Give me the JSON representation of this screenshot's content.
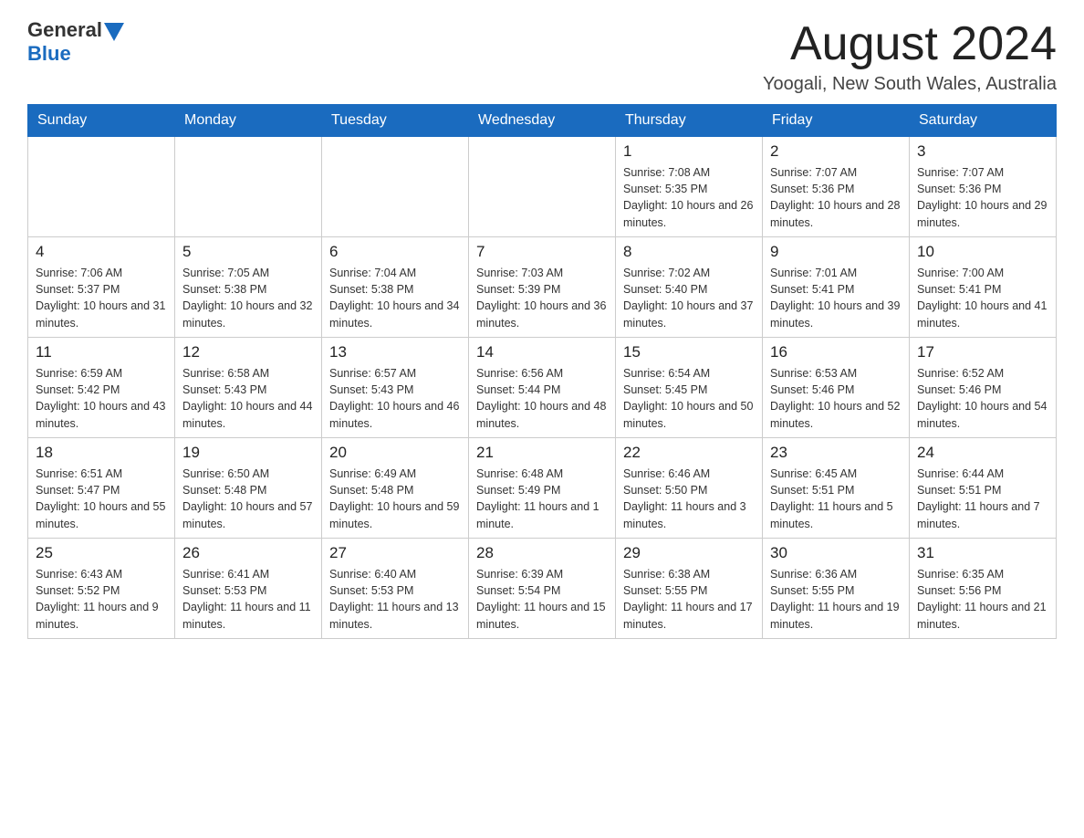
{
  "header": {
    "logo": {
      "general": "General",
      "blue": "Blue"
    },
    "title": "August 2024",
    "location": "Yoogali, New South Wales, Australia"
  },
  "calendar": {
    "days_of_week": [
      "Sunday",
      "Monday",
      "Tuesday",
      "Wednesday",
      "Thursday",
      "Friday",
      "Saturday"
    ],
    "weeks": [
      [
        {
          "num": "",
          "sunrise": "",
          "sunset": "",
          "daylight": ""
        },
        {
          "num": "",
          "sunrise": "",
          "sunset": "",
          "daylight": ""
        },
        {
          "num": "",
          "sunrise": "",
          "sunset": "",
          "daylight": ""
        },
        {
          "num": "",
          "sunrise": "",
          "sunset": "",
          "daylight": ""
        },
        {
          "num": "1",
          "sunrise": "Sunrise: 7:08 AM",
          "sunset": "Sunset: 5:35 PM",
          "daylight": "Daylight: 10 hours and 26 minutes."
        },
        {
          "num": "2",
          "sunrise": "Sunrise: 7:07 AM",
          "sunset": "Sunset: 5:36 PM",
          "daylight": "Daylight: 10 hours and 28 minutes."
        },
        {
          "num": "3",
          "sunrise": "Sunrise: 7:07 AM",
          "sunset": "Sunset: 5:36 PM",
          "daylight": "Daylight: 10 hours and 29 minutes."
        }
      ],
      [
        {
          "num": "4",
          "sunrise": "Sunrise: 7:06 AM",
          "sunset": "Sunset: 5:37 PM",
          "daylight": "Daylight: 10 hours and 31 minutes."
        },
        {
          "num": "5",
          "sunrise": "Sunrise: 7:05 AM",
          "sunset": "Sunset: 5:38 PM",
          "daylight": "Daylight: 10 hours and 32 minutes."
        },
        {
          "num": "6",
          "sunrise": "Sunrise: 7:04 AM",
          "sunset": "Sunset: 5:38 PM",
          "daylight": "Daylight: 10 hours and 34 minutes."
        },
        {
          "num": "7",
          "sunrise": "Sunrise: 7:03 AM",
          "sunset": "Sunset: 5:39 PM",
          "daylight": "Daylight: 10 hours and 36 minutes."
        },
        {
          "num": "8",
          "sunrise": "Sunrise: 7:02 AM",
          "sunset": "Sunset: 5:40 PM",
          "daylight": "Daylight: 10 hours and 37 minutes."
        },
        {
          "num": "9",
          "sunrise": "Sunrise: 7:01 AM",
          "sunset": "Sunset: 5:41 PM",
          "daylight": "Daylight: 10 hours and 39 minutes."
        },
        {
          "num": "10",
          "sunrise": "Sunrise: 7:00 AM",
          "sunset": "Sunset: 5:41 PM",
          "daylight": "Daylight: 10 hours and 41 minutes."
        }
      ],
      [
        {
          "num": "11",
          "sunrise": "Sunrise: 6:59 AM",
          "sunset": "Sunset: 5:42 PM",
          "daylight": "Daylight: 10 hours and 43 minutes."
        },
        {
          "num": "12",
          "sunrise": "Sunrise: 6:58 AM",
          "sunset": "Sunset: 5:43 PM",
          "daylight": "Daylight: 10 hours and 44 minutes."
        },
        {
          "num": "13",
          "sunrise": "Sunrise: 6:57 AM",
          "sunset": "Sunset: 5:43 PM",
          "daylight": "Daylight: 10 hours and 46 minutes."
        },
        {
          "num": "14",
          "sunrise": "Sunrise: 6:56 AM",
          "sunset": "Sunset: 5:44 PM",
          "daylight": "Daylight: 10 hours and 48 minutes."
        },
        {
          "num": "15",
          "sunrise": "Sunrise: 6:54 AM",
          "sunset": "Sunset: 5:45 PM",
          "daylight": "Daylight: 10 hours and 50 minutes."
        },
        {
          "num": "16",
          "sunrise": "Sunrise: 6:53 AM",
          "sunset": "Sunset: 5:46 PM",
          "daylight": "Daylight: 10 hours and 52 minutes."
        },
        {
          "num": "17",
          "sunrise": "Sunrise: 6:52 AM",
          "sunset": "Sunset: 5:46 PM",
          "daylight": "Daylight: 10 hours and 54 minutes."
        }
      ],
      [
        {
          "num": "18",
          "sunrise": "Sunrise: 6:51 AM",
          "sunset": "Sunset: 5:47 PM",
          "daylight": "Daylight: 10 hours and 55 minutes."
        },
        {
          "num": "19",
          "sunrise": "Sunrise: 6:50 AM",
          "sunset": "Sunset: 5:48 PM",
          "daylight": "Daylight: 10 hours and 57 minutes."
        },
        {
          "num": "20",
          "sunrise": "Sunrise: 6:49 AM",
          "sunset": "Sunset: 5:48 PM",
          "daylight": "Daylight: 10 hours and 59 minutes."
        },
        {
          "num": "21",
          "sunrise": "Sunrise: 6:48 AM",
          "sunset": "Sunset: 5:49 PM",
          "daylight": "Daylight: 11 hours and 1 minute."
        },
        {
          "num": "22",
          "sunrise": "Sunrise: 6:46 AM",
          "sunset": "Sunset: 5:50 PM",
          "daylight": "Daylight: 11 hours and 3 minutes."
        },
        {
          "num": "23",
          "sunrise": "Sunrise: 6:45 AM",
          "sunset": "Sunset: 5:51 PM",
          "daylight": "Daylight: 11 hours and 5 minutes."
        },
        {
          "num": "24",
          "sunrise": "Sunrise: 6:44 AM",
          "sunset": "Sunset: 5:51 PM",
          "daylight": "Daylight: 11 hours and 7 minutes."
        }
      ],
      [
        {
          "num": "25",
          "sunrise": "Sunrise: 6:43 AM",
          "sunset": "Sunset: 5:52 PM",
          "daylight": "Daylight: 11 hours and 9 minutes."
        },
        {
          "num": "26",
          "sunrise": "Sunrise: 6:41 AM",
          "sunset": "Sunset: 5:53 PM",
          "daylight": "Daylight: 11 hours and 11 minutes."
        },
        {
          "num": "27",
          "sunrise": "Sunrise: 6:40 AM",
          "sunset": "Sunset: 5:53 PM",
          "daylight": "Daylight: 11 hours and 13 minutes."
        },
        {
          "num": "28",
          "sunrise": "Sunrise: 6:39 AM",
          "sunset": "Sunset: 5:54 PM",
          "daylight": "Daylight: 11 hours and 15 minutes."
        },
        {
          "num": "29",
          "sunrise": "Sunrise: 6:38 AM",
          "sunset": "Sunset: 5:55 PM",
          "daylight": "Daylight: 11 hours and 17 minutes."
        },
        {
          "num": "30",
          "sunrise": "Sunrise: 6:36 AM",
          "sunset": "Sunset: 5:55 PM",
          "daylight": "Daylight: 11 hours and 19 minutes."
        },
        {
          "num": "31",
          "sunrise": "Sunrise: 6:35 AM",
          "sunset": "Sunset: 5:56 PM",
          "daylight": "Daylight: 11 hours and 21 minutes."
        }
      ]
    ]
  }
}
